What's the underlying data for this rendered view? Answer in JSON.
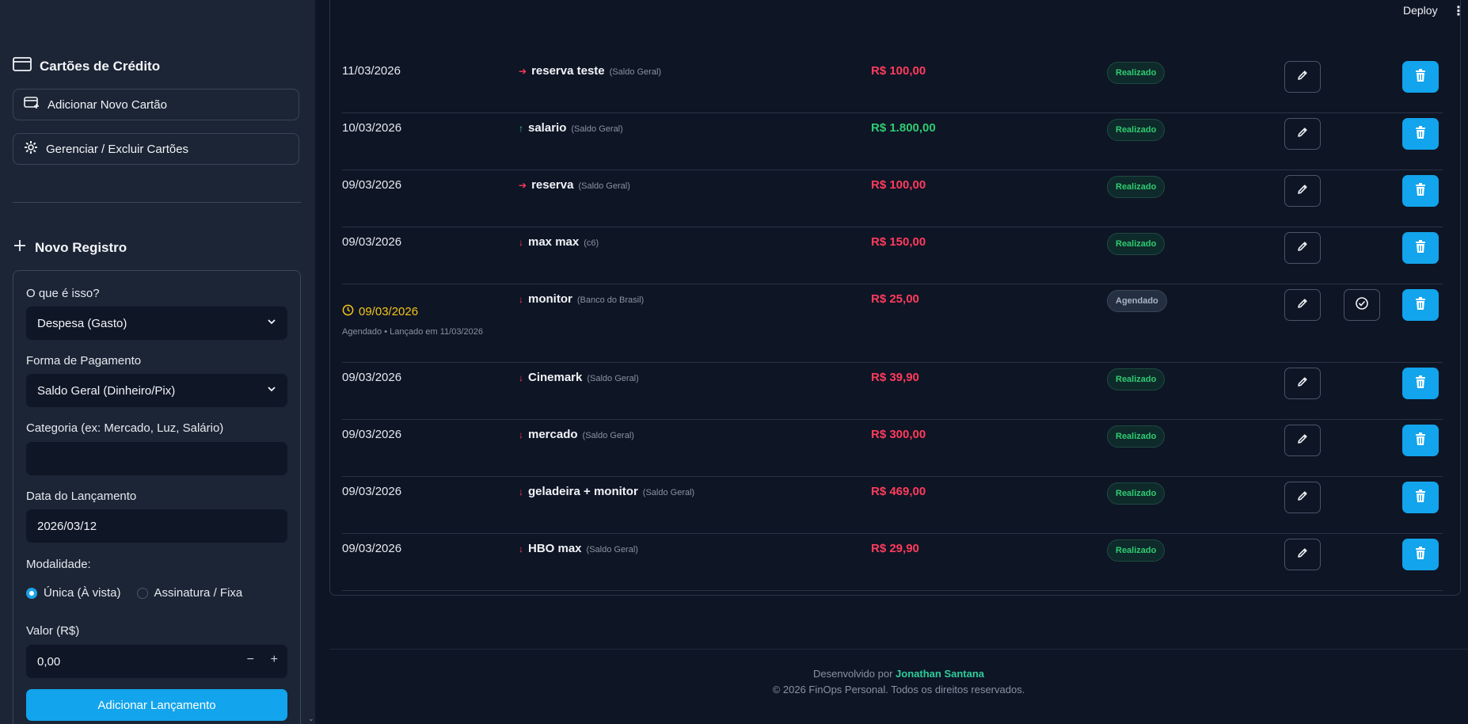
{
  "topbar": {
    "deploy_label": "Deploy",
    "menu_icon": "kebab-menu-icon"
  },
  "sidebar": {
    "cards_title": "Cartões de Crédito",
    "add_card_label": "Adicionar Novo Cartão",
    "manage_cards_label": "Gerenciar / Excluir Cartões",
    "new_record_title": "Novo Registro",
    "form": {
      "type_label": "O que é isso?",
      "type_value": "Despesa (Gasto)",
      "payment_label": "Forma de Pagamento",
      "payment_value": "Saldo Geral (Dinheiro/Pix)",
      "category_label": "Categoria (ex: Mercado, Luz, Salário)",
      "category_value": "",
      "date_label": "Data do Lançamento",
      "date_value": "2026/03/12",
      "mode_label": "Modalidade:",
      "mode_options": [
        "Única (À vista)",
        "Assinatura / Fixa"
      ],
      "mode_selected": "Única (À vista)",
      "value_label": "Valor (R$)",
      "value_value": "0,00",
      "minus": "−",
      "plus": "+",
      "submit_label": "Adicionar Lançamento"
    }
  },
  "colors": {
    "expense": "#ff3b5c",
    "income": "#2ecc71",
    "accent": "#12a4ec",
    "scheduled": "#f5c518"
  },
  "transactions": [
    {
      "date": "11/03/2026",
      "direction": "transfer",
      "name": "reserva teste",
      "account": "(Saldo Geral)",
      "value": "R$ 100,00",
      "kind": "expense",
      "status": "Realizado"
    },
    {
      "date": "10/03/2026",
      "direction": "in",
      "name": "salario",
      "account": "(Saldo Geral)",
      "value": "R$ 1.800,00",
      "kind": "income",
      "status": "Realizado"
    },
    {
      "date": "09/03/2026",
      "direction": "transfer",
      "name": "reserva",
      "account": "(Saldo Geral)",
      "value": "R$ 100,00",
      "kind": "expense",
      "status": "Realizado"
    },
    {
      "date": "09/03/2026",
      "direction": "out",
      "name": "max max",
      "account": "(c6)",
      "value": "R$ 150,00",
      "kind": "expense",
      "status": "Realizado"
    },
    {
      "date": "09/03/2026",
      "direction": "out",
      "name": "monitor",
      "account": "(Banco do Brasil)",
      "value": "R$ 25,00",
      "kind": "expense",
      "status": "Agendado",
      "scheduled": true,
      "sub": "Agendado • Lançado em 11/03/2026"
    },
    {
      "date": "09/03/2026",
      "direction": "out",
      "name": "Cinemark",
      "account": "(Saldo Geral)",
      "value": "R$ 39,90",
      "kind": "expense",
      "status": "Realizado"
    },
    {
      "date": "09/03/2026",
      "direction": "out",
      "name": "mercado",
      "account": "(Saldo Geral)",
      "value": "R$ 300,00",
      "kind": "expense",
      "status": "Realizado"
    },
    {
      "date": "09/03/2026",
      "direction": "out",
      "name": "geladeira + monitor",
      "account": "(Saldo Geral)",
      "value": "R$ 469,00",
      "kind": "expense",
      "status": "Realizado"
    },
    {
      "date": "09/03/2026",
      "direction": "out",
      "name": "HBO max",
      "account": "(Saldo Geral)",
      "value": "R$ 29,90",
      "kind": "expense",
      "status": "Realizado"
    }
  ],
  "footer": {
    "dev_prefix": "Desenvolvido por",
    "author": "Jonathan Santana",
    "copyright": "© 2026 FinOps Personal. Todos os direitos reservados."
  }
}
